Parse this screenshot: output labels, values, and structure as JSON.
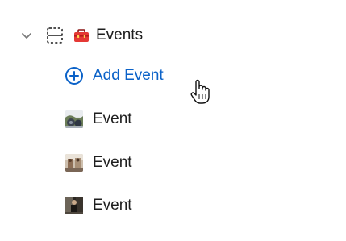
{
  "tree": {
    "group": {
      "label": "Events",
      "expanded": true,
      "chevron_icon": "chevron-down-icon",
      "section_icon": "dashed-section-icon",
      "emoji_icon": "toolbox-icon"
    },
    "add_item": {
      "label": "Add Event",
      "icon": "add-circle-icon",
      "color": "#0b62c8"
    },
    "items": [
      {
        "label": "Event",
        "thumbnail": "photo-thumbnail-1"
      },
      {
        "label": "Event",
        "thumbnail": "photo-thumbnail-2"
      },
      {
        "label": "Event",
        "thumbnail": "photo-thumbnail-3"
      }
    ]
  },
  "cursor": {
    "type": "pointer-hand"
  }
}
